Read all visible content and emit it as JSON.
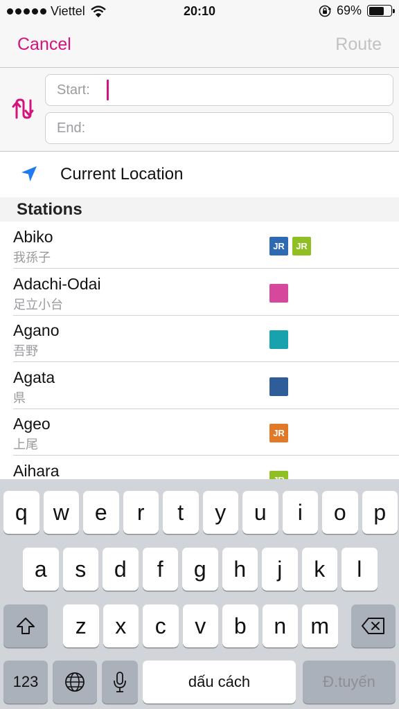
{
  "status_bar": {
    "carrier": "Viettel",
    "time": "20:10",
    "battery": "69%",
    "battery_level": 0.69,
    "icons": [
      "signal-dots-icon",
      "wifi-icon",
      "rotation-lock-icon",
      "battery-icon"
    ]
  },
  "nav": {
    "cancel_label": "Cancel",
    "route_label": "Route"
  },
  "route": {
    "start_label": "Start:",
    "end_label": "End:",
    "start_value": "",
    "end_value": ""
  },
  "current_location": {
    "label": "Current Location"
  },
  "stations_section": {
    "title": "Stations"
  },
  "stations": [
    {
      "name": "Abiko",
      "kanji": "我孫子",
      "badges": [
        {
          "text": "JR",
          "color": "#2e6ab1"
        },
        {
          "text": "JR",
          "color": "#8fbf22"
        }
      ]
    },
    {
      "name": "Adachi-Odai",
      "kanji": "足立小台",
      "badges": [
        {
          "text": "",
          "color": "#d6489b"
        }
      ]
    },
    {
      "name": "Agano",
      "kanji": "吾野",
      "badges": [
        {
          "text": "",
          "color": "#17a2ad"
        }
      ]
    },
    {
      "name": "Agata",
      "kanji": "県",
      "badges": [
        {
          "text": "",
          "color": "#2f5d9a"
        }
      ]
    },
    {
      "name": "Ageo",
      "kanji": "上尾",
      "badges": [
        {
          "text": "JR",
          "color": "#e07a28"
        }
      ]
    },
    {
      "name": "Aihara",
      "kanji": "",
      "badges": [
        {
          "text": "JR",
          "color": "#8fbf22"
        }
      ]
    }
  ],
  "colors": {
    "accent": "#d6127e",
    "disabled": "#c2c2c4",
    "location_blue": "#1e7cf0"
  },
  "keyboard": {
    "row1": [
      "q",
      "w",
      "e",
      "r",
      "t",
      "y",
      "u",
      "i",
      "o",
      "p"
    ],
    "row2": [
      "a",
      "s",
      "d",
      "f",
      "g",
      "h",
      "j",
      "k",
      "l"
    ],
    "row3": [
      "z",
      "x",
      "c",
      "v",
      "b",
      "n",
      "m"
    ],
    "numbers_label": "123",
    "space_label": "dấu cách",
    "return_label": "Đ.tuyến"
  }
}
